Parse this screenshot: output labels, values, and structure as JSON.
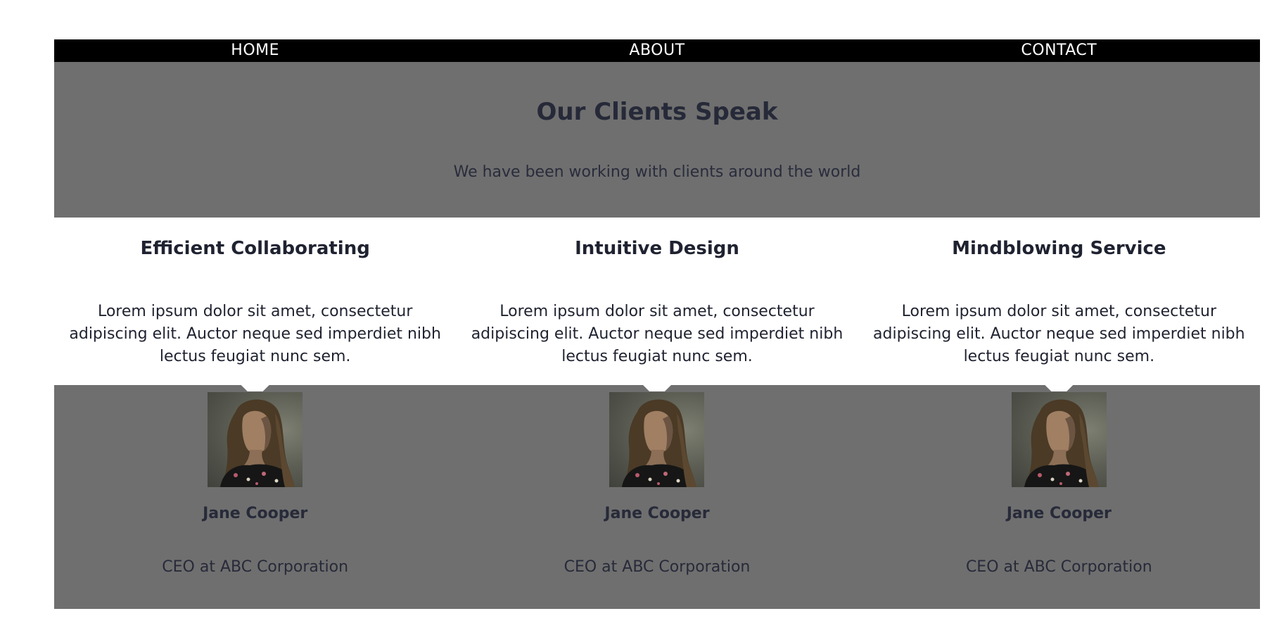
{
  "nav": {
    "items": [
      {
        "label": "HOME"
      },
      {
        "label": "ABOUT"
      },
      {
        "label": "CONTACT"
      }
    ]
  },
  "hero": {
    "title": "Our Clients Speak",
    "subtitle": "We have been working with clients around the world"
  },
  "features": [
    {
      "title": "Efficient Collaborating",
      "text": "Lorem ipsum dolor sit amet, consectetur adipiscing elit. Auctor neque sed imperdiet nibh lectus feugiat nunc sem."
    },
    {
      "title": "Intuitive Design",
      "text": "Lorem ipsum dolor sit amet, consectetur adipiscing elit. Auctor neque sed imperdiet nibh lectus feugiat nunc sem."
    },
    {
      "title": "Mindblowing Service",
      "text": "Lorem ipsum dolor sit amet, consectetur adipiscing elit. Auctor neque sed imperdiet nibh lectus feugiat nunc sem."
    }
  ],
  "clients": [
    {
      "name": "Jane Cooper",
      "role": "CEO at ABC Corporation"
    },
    {
      "name": "Jane Cooper",
      "role": "CEO at ABC Corporation"
    },
    {
      "name": "Jane Cooper",
      "role": "CEO at ABC Corporation"
    }
  ],
  "colors": {
    "nav_bg": "#000000",
    "section_bg": "#6f6f6f",
    "text_dark": "#272a3a"
  }
}
